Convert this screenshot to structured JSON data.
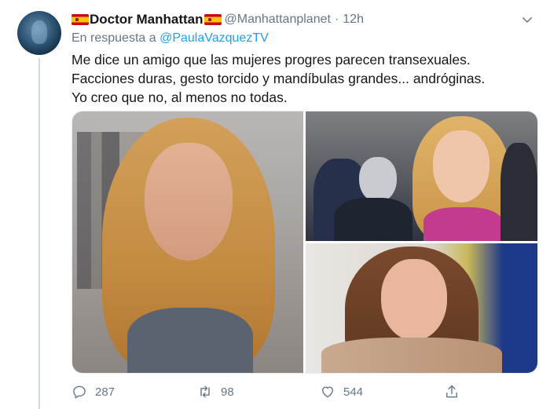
{
  "tweet": {
    "display_name": "Doctor Manhattan",
    "handle": "@Manhattanplanet",
    "separator": "·",
    "time": "12h",
    "reply_prefix": "En respuesta a",
    "reply_to": "@PaulaVazquezTV",
    "text_lines": [
      "Me dice un amigo que las mujeres progres parecen transexuales.",
      "Facciones duras, gesto torcido y mandíbulas grandes... andróginas.",
      "Yo creo que no, al menos no todas."
    ]
  },
  "icons": {
    "flag": "spain-flag-icon",
    "menu": "chevron-down-icon",
    "reply": "reply-icon",
    "retweet": "retweet-icon",
    "like": "heart-icon",
    "share": "share-icon"
  },
  "actions": {
    "replies": "287",
    "retweets": "98",
    "likes": "544"
  },
  "colors": {
    "accent": "#1da1f2",
    "secondary_text": "#657786",
    "primary_text": "#14171a",
    "flag_red": "#c60b1e",
    "flag_yellow": "#ffc400"
  }
}
